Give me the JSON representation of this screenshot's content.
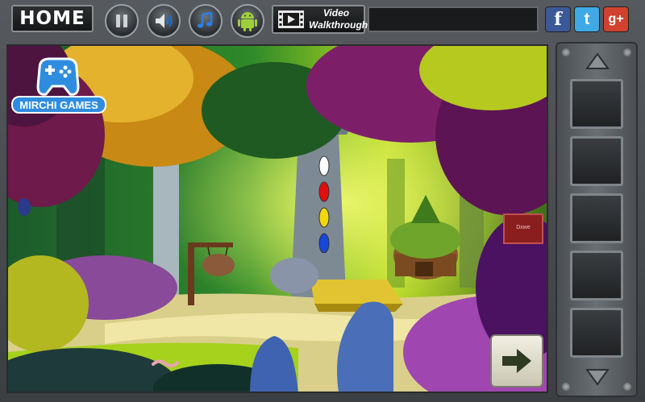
{
  "toolbar": {
    "home_label": "HOME",
    "video_label_line1": "Video",
    "video_label_line2": "Walkthrough",
    "social": [
      {
        "name": "facebook",
        "glyph": "f",
        "color": "#3b5998"
      },
      {
        "name": "twitter",
        "glyph": "t",
        "color": "#3fa9e6"
      },
      {
        "name": "google-plus",
        "glyph": "g+",
        "color": "#d0422e"
      }
    ]
  },
  "brand": {
    "logo_text": "MIRCHI GAMES"
  },
  "scene": {
    "sign_text": "Dxwe",
    "color_clue": [
      "#ffffff",
      "#e01010",
      "#f2d60e",
      "#1746d8"
    ]
  },
  "inventory": {
    "slot_count": 5
  },
  "icons": {
    "pause": "pause-icon",
    "sound": "speaker-icon",
    "music": "music-note-icon",
    "android": "android-icon",
    "video": "film-icon",
    "next": "arrow-right-icon"
  }
}
